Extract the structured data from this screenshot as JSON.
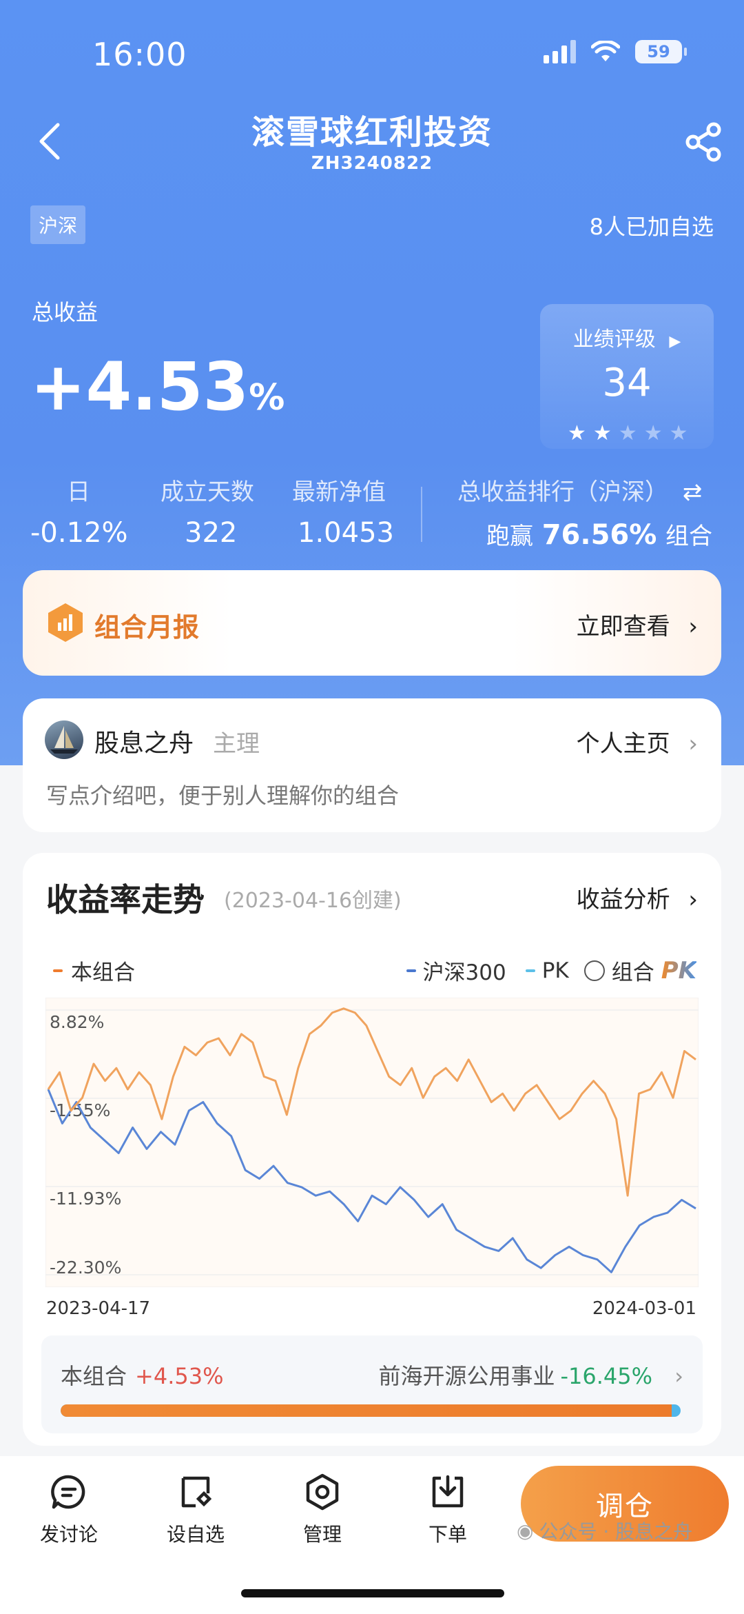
{
  "status_bar": {
    "time": "16:00",
    "battery": "59"
  },
  "nav": {
    "title": "滚雪球红利投资",
    "code": "ZH3240822"
  },
  "market_tag": "沪深",
  "watch_count": "8人已加自选",
  "summary": {
    "total_label": "总收益",
    "total_value": "+4.53",
    "total_unit": "%",
    "rating_title": "业绩评级",
    "rating_score": "34",
    "rating_stars": 2,
    "rating_stars_max": 5
  },
  "stats": {
    "day_label": "日",
    "day_value": "-0.12%",
    "days_label": "成立天数",
    "days_value": "322",
    "nav_label": "最新净值",
    "nav_value": "1.0453",
    "rank_label": "总收益排行（沪深）",
    "rank_prefix": "跑赢",
    "rank_value": "76.56%",
    "rank_suffix": "组合"
  },
  "report": {
    "title": "组合月报",
    "link": "立即查看"
  },
  "owner": {
    "name": "股息之舟",
    "role": "主理",
    "link": "个人主页",
    "desc": "写点介绍吧，便于别人理解你的组合"
  },
  "chart_section": {
    "title": "收益率走势",
    "created": "(2023-04-16创建)",
    "link": "收益分析",
    "legend_self": "本组合",
    "legend_index": "沪深300",
    "legend_pk": "PK",
    "legend_combo": "组合",
    "pk_logo": "PK",
    "date_start": "2023-04-17",
    "date_end": "2024-03-01"
  },
  "chart_data": {
    "type": "line",
    "x_range": [
      "2023-04-17",
      "2024-03-01"
    ],
    "y_ticks": [
      "8.82%",
      "-1.55%",
      "-11.93%",
      "-22.30%"
    ],
    "y_tick_values": [
      8.82,
      -1.55,
      -11.93,
      -22.3
    ],
    "ylim": [
      -22.3,
      8.82
    ],
    "grid": true,
    "series": [
      {
        "name": "本组合",
        "color": "#f0a35e",
        "values": [
          -0.5,
          1.5,
          -3.0,
          -1.5,
          2.5,
          0.5,
          2.0,
          -0.5,
          1.5,
          0.0,
          -4.0,
          1.0,
          4.5,
          3.5,
          5.0,
          5.5,
          3.5,
          6.0,
          5.0,
          1.0,
          0.5,
          -3.5,
          2.0,
          6.0,
          7.0,
          8.5,
          9.0,
          8.5,
          7.0,
          4.0,
          1.0,
          0.0,
          2.0,
          -1.5,
          1.0,
          2.0,
          0.5,
          3.0,
          0.5,
          -2.0,
          -1.0,
          -3.0,
          -1.0,
          0.0,
          -2.0,
          -4.0,
          -3.0,
          -1.0,
          0.5,
          -1.0,
          -4.0,
          -13.0,
          -1.0,
          -0.5,
          1.5,
          -1.5,
          4.0,
          3.0
        ]
      },
      {
        "name": "沪深300",
        "color": "#5a86d6",
        "values": [
          -0.5,
          -4.5,
          -2.0,
          -5.0,
          -6.5,
          -8.0,
          -5.0,
          -7.5,
          -5.5,
          -7.0,
          -3.0,
          -2.0,
          -4.5,
          -6.0,
          -10.0,
          -11.0,
          -9.5,
          -11.5,
          -12.0,
          -13.0,
          -12.5,
          -14.0,
          -16.0,
          -13.0,
          -14.0,
          -12.0,
          -13.5,
          -15.5,
          -14.0,
          -17.0,
          -18.0,
          -19.0,
          -19.5,
          -18.0,
          -20.5,
          -21.5,
          -20.0,
          -19.0,
          -20.0,
          -20.5,
          -22.0,
          -19.0,
          -16.5,
          -15.5,
          -15.0,
          -13.5,
          -14.5
        ]
      }
    ]
  },
  "compare": {
    "self_label": "本组合",
    "self_value": "+4.53%",
    "other_label": "前海开源公用事业",
    "other_value": "-16.45%",
    "self_share": 0.985
  },
  "bottom_bar": {
    "discuss": "发讨论",
    "watch": "设自选",
    "manage": "管理",
    "order": "下单",
    "trade": "调仓"
  },
  "watermark": "公众号 · 股息之舟",
  "colors": {
    "hero": "#5b93f3",
    "accent_orange": "#ef7c2e",
    "up_red": "#e0564c",
    "down_green": "#2aa56b"
  }
}
